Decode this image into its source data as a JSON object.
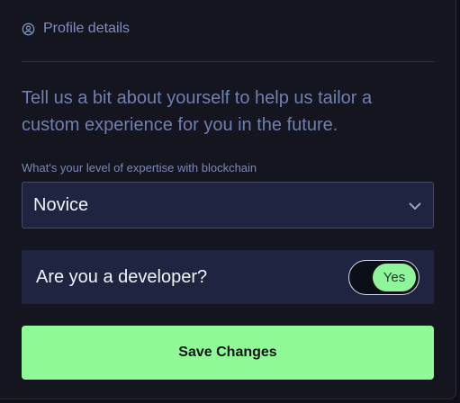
{
  "profile_section": {
    "title": "Profile details",
    "icon": "user-circle-icon"
  },
  "intro_text": "Tell us a bit about yourself to help us tailor a custom experience for you in the future.",
  "expertise": {
    "label": "What's your level of expertise with blockchain",
    "selected": "Novice",
    "icon": "chevron-down-icon"
  },
  "developer": {
    "question": "Are you a developer?",
    "toggle_label": "Yes",
    "toggle_on": true
  },
  "actions": {
    "save_label": "Save Changes"
  },
  "colors": {
    "background": "#15151f",
    "card": "#1f2540",
    "accent_green": "#90fb96",
    "muted_text": "#6f7fb0"
  }
}
